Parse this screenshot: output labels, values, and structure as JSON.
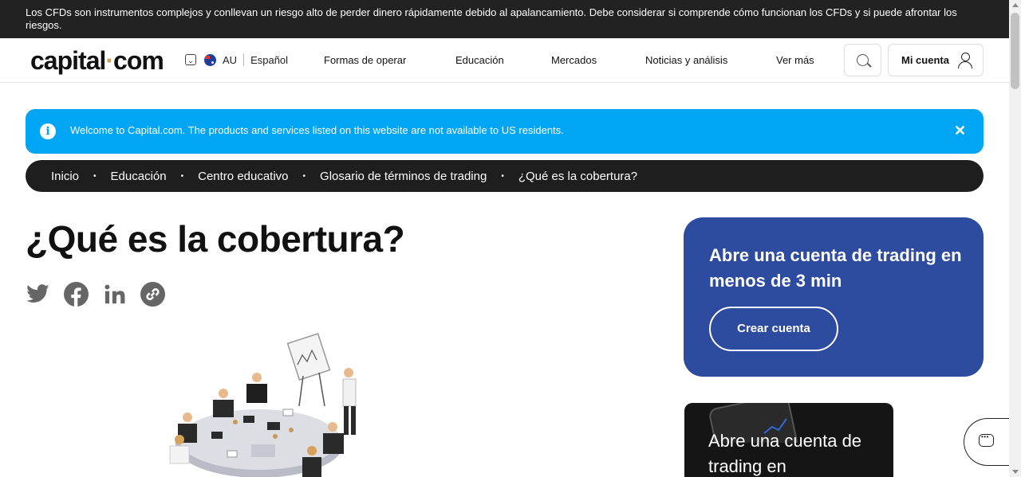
{
  "risk_warning": "Los CFDs son instrumentos complejos y conllevan un riesgo alto de perder dinero rápidamente debido al apalancamiento. Debe considerar si comprende cómo funcionan los CFDs y si puede afrontar los riesgos.",
  "header": {
    "logo_left": "capital",
    "logo_dot": "·",
    "logo_right": "com",
    "region": "AU",
    "language": "Español",
    "nav": [
      "Formas de operar",
      "Educación",
      "Mercados",
      "Noticias y análisis",
      "Ver más"
    ],
    "account_label": "Mi cuenta",
    "icons": {
      "search": "search-icon",
      "account": "user-icon",
      "region_flag": "australia-flag-icon"
    }
  },
  "info_banner": {
    "text": "Welcome to Capital.com. The products and services listed on this website are not available to US residents.",
    "icon": "i",
    "close": "✕"
  },
  "breadcrumb": [
    "Inicio",
    "Educación",
    "Centro educativo",
    "Glosario de términos de trading",
    "¿Qué es la cobertura?"
  ],
  "article": {
    "title": "¿Qué es la cobertura?",
    "share_icons": [
      "twitter-icon",
      "facebook-icon",
      "linkedin-icon",
      "copy-link-icon"
    ]
  },
  "cta": {
    "title": "Abre una cuenta de trading en menos de 3 min",
    "button": "Crear cuenta"
  },
  "promo": {
    "text": "Abre una cuenta de trading en"
  },
  "colors": {
    "risk_bar": "#222222",
    "info_banner": "#00a6f4",
    "breadcrumb_bg": "#1e1e1e",
    "cta_card": "#2d4b9f",
    "logo_dot": "#c4a25a"
  }
}
